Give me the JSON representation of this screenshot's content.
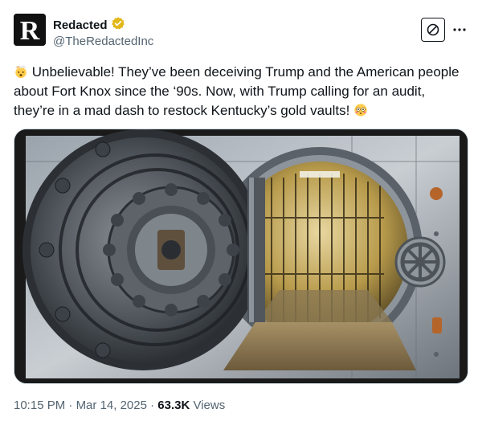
{
  "author": {
    "display_name": "Redacted",
    "handle": "@TheRedactedInc",
    "avatar_letter": "R",
    "verified_badge_color": "#e2b719"
  },
  "header": {
    "subscribe_icon": "ban-circle-icon",
    "more_icon": "more-horizontal-icon",
    "more_label": "···"
  },
  "post": {
    "leading_emoji": "exploding-head",
    "text": "Unbelievable! They’ve been deceiving Trump and the American people about Fort Knox since the ‘90s. Now, with Trump calling for an audit, they’re in a mad dash to restock Kentucky’s gold vaults!",
    "trailing_emoji": "flushed-face"
  },
  "media": {
    "description_icon": "bank-vault-image"
  },
  "meta": {
    "time": "10:15 PM",
    "separator": " · ",
    "date": "Mar 14, 2025",
    "dot": " · ",
    "views_count": "63.3K",
    "views_label": " Views"
  },
  "colors": {
    "text_primary": "#0f1419",
    "text_secondary": "#536471",
    "border": "#cfd9de",
    "gold_badge": "#e2b719"
  }
}
